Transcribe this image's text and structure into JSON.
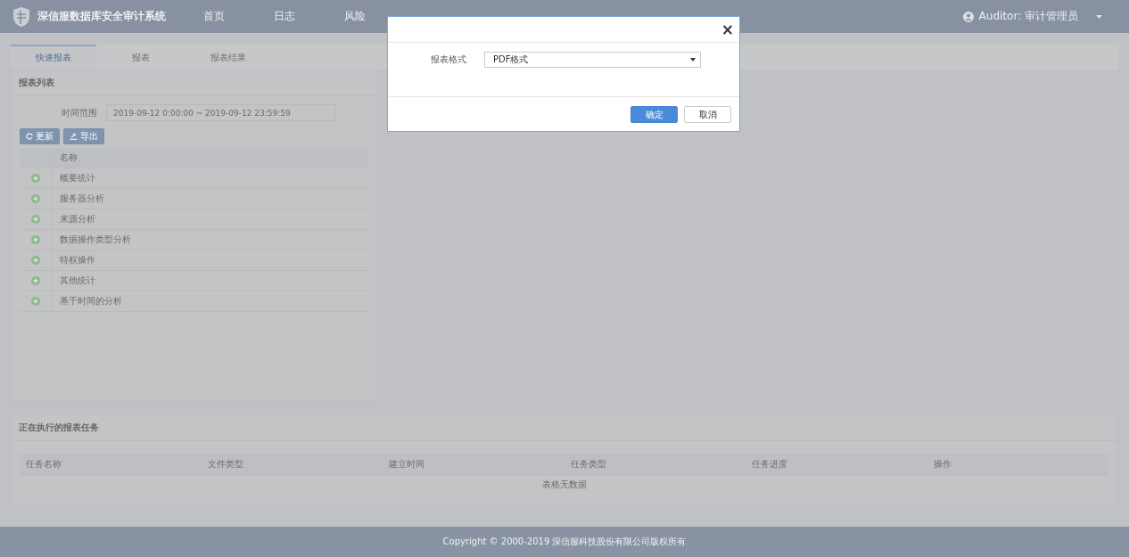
{
  "header": {
    "title": "深信服数据库安全审计系统",
    "nav": [
      "首页",
      "日志",
      "风险"
    ],
    "user": "Auditor:  审计管理员"
  },
  "tabs": [
    {
      "label": "快速报表",
      "selected": true
    },
    {
      "label": "报表",
      "selected": false
    },
    {
      "label": "报表结果",
      "selected": false
    }
  ],
  "report_list": {
    "title": "报表列表",
    "time_range": {
      "label": "时间范围",
      "value": "2019-09-12 0:00:00 ~ 2019-09-12 23:59:59"
    },
    "buttons": [
      {
        "label": "更新",
        "kind": "refresh"
      },
      {
        "label": "导出",
        "kind": "export"
      }
    ],
    "column": "名称",
    "rows": [
      "概要统计",
      "服务器分析",
      "来源分析",
      "数据操作类型分析",
      "特权操作",
      "其他统计",
      "基于时间的分析"
    ]
  },
  "tasks": {
    "title": "正在执行的报表任务",
    "columns": [
      "任务名称",
      "文件类型",
      "建立时间",
      "任务类型",
      "任务进度",
      "操作"
    ],
    "empty": "表格无数据"
  },
  "footer": "Copyright © 2000-2019 深信服科技股份有限公司版权所有",
  "dialog": {
    "close": "×",
    "field": {
      "label": "报表格式",
      "value": "PDF格式"
    },
    "buttons": [
      {
        "label": "确定",
        "kind": "primary"
      },
      {
        "label": "取消",
        "kind": "default"
      }
    ]
  }
}
